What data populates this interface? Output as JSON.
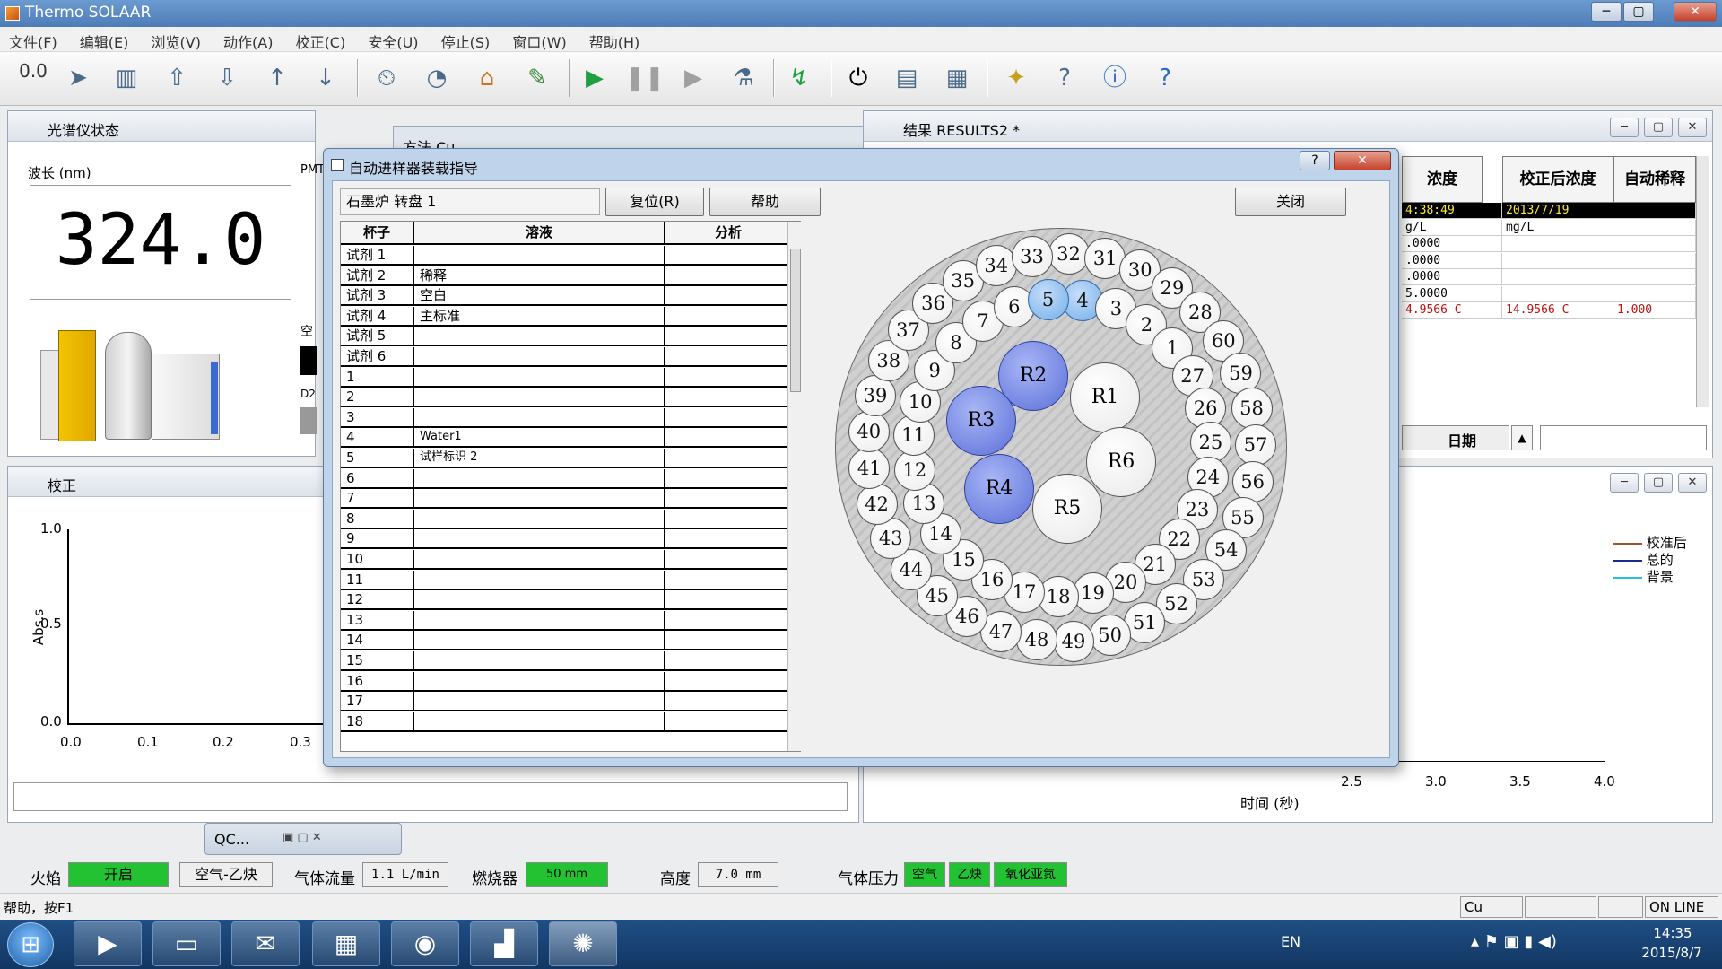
{
  "window": {
    "title": "Thermo SOLAAR",
    "min": "─",
    "max": "▢",
    "close": "✕"
  },
  "menu": [
    "文件(F)",
    "编辑(E)",
    "浏览(V)",
    "动作(A)",
    "校正(C)",
    "安全(U)",
    "停止(S)",
    "窗口(W)",
    "帮助(H)"
  ],
  "toolbar": {
    "icons": [
      "zero-icon",
      "autozero-icon",
      "lamp-icon",
      "sampler-up-icon",
      "sampler-down-icon",
      "arrow-up-icon",
      "arrow-down-icon",
      "timer-icon",
      "clock-icon",
      "clean-icon",
      "green-tool-icon",
      "play-icon",
      "pause-icon",
      "step-icon",
      "sample-icon",
      "sequence-icon",
      "power-icon",
      "instrument-icon",
      "report-icon",
      "wand-icon",
      "pointer-help-icon",
      "info-icon",
      "whats-this-icon"
    ],
    "zero_label": "0.0"
  },
  "spectro": {
    "title": "光谱仪状态",
    "wavelength_label": "波长 (nm)",
    "wavelength": "324.0",
    "pmt_label": "PMT",
    "air_label": "空",
    "d2_label": "D2"
  },
  "behind": {
    "method": "方法 Cu",
    "results": "结果 RESULTS2 *"
  },
  "results_table": {
    "headers": [
      "浓度",
      "校正后浓度",
      "自动稀释"
    ],
    "rows": [
      [
        "4:38:49",
        "2013/7/19",
        ""
      ],
      [
        "g/L",
        "mg/L",
        ""
      ],
      [
        ".0000",
        "",
        ""
      ],
      [
        ".0000",
        "",
        ""
      ],
      [
        ".0000",
        "",
        ""
      ],
      [
        "5.0000",
        "",
        ""
      ],
      [
        "4.9566 C",
        "14.9566 C",
        "1.000"
      ]
    ],
    "date_label": "日期"
  },
  "calib": {
    "title": "校正",
    "yaxis": "Abs.s",
    "yticks": [
      "1.0",
      "0.5",
      "0.0"
    ],
    "xticks": [
      "0.0",
      "0.1",
      "0.2",
      "0.3"
    ]
  },
  "right_plot": {
    "xticks": [
      "2.5",
      "3.0",
      "3.5",
      "4.0"
    ],
    "xlabel": "时间 (秒)",
    "legend": [
      "校准后",
      "总的",
      "背景"
    ],
    "legend_colors": [
      "#a0522d",
      "#1a2a8a",
      "#20c0e0"
    ]
  },
  "qc": {
    "title": "QC..."
  },
  "status": {
    "flame_label": "火焰",
    "flame_value": "开启",
    "gas_type": "空气-乙炔",
    "flow_label": "气体流量",
    "flow_value": "1.1 L/min",
    "burner_label": "燃烧器",
    "burner_value": "50 mm",
    "height_label": "高度",
    "height_value": "7.0 mm",
    "pressure_label": "气体压力",
    "pressure_items": [
      "空气",
      "乙炔",
      "氧化亚氮"
    ]
  },
  "statusline": {
    "help": "帮助，按F1",
    "element": "Cu",
    "online": "ON LINE"
  },
  "taskbar": {
    "lang": "EN",
    "time": "14:35",
    "date": "2015/8/7"
  },
  "dialog": {
    "title": "自动进样器装载指导",
    "furnace": "石墨炉  转盘 1",
    "reset": "复位(R)",
    "help": "帮助",
    "close": "关闭",
    "columns": [
      "杯子",
      "溶液",
      "分析"
    ],
    "rows": [
      [
        "试剂   1",
        "",
        ""
      ],
      [
        "试剂   2",
        "稀释",
        ""
      ],
      [
        "试剂   3",
        "空白",
        ""
      ],
      [
        "试剂   4",
        "主标准",
        ""
      ],
      [
        "试剂   5",
        "",
        ""
      ],
      [
        "试剂   6",
        "",
        ""
      ],
      [
        "1",
        "",
        ""
      ],
      [
        "2",
        "",
        ""
      ],
      [
        "3",
        "",
        ""
      ],
      [
        "4",
        "Water1",
        ""
      ],
      [
        "5",
        "试样标识 2",
        ""
      ],
      [
        "6",
        "",
        ""
      ],
      [
        "7",
        "",
        ""
      ],
      [
        "8",
        "",
        ""
      ],
      [
        "9",
        "",
        ""
      ],
      [
        "10",
        "",
        ""
      ],
      [
        "11",
        "",
        ""
      ],
      [
        "12",
        "",
        ""
      ],
      [
        "13",
        "",
        ""
      ],
      [
        "14",
        "",
        ""
      ],
      [
        "15",
        "",
        ""
      ],
      [
        "16",
        "",
        ""
      ],
      [
        "17",
        "",
        ""
      ],
      [
        "18",
        "",
        ""
      ]
    ],
    "tray": {
      "outer": [
        "32",
        "31",
        "30",
        "29",
        "28",
        "60",
        "59",
        "58",
        "57",
        "56",
        "55",
        "54",
        "53",
        "52",
        "51",
        "50",
        "49",
        "48",
        "47",
        "46",
        "45",
        "44",
        "43",
        "42",
        "41",
        "40",
        "39",
        "38",
        "37",
        "36",
        "35",
        "34",
        "33"
      ],
      "middle": [
        "4",
        "3",
        "2",
        "1",
        "27",
        "26",
        "25",
        "24",
        "23",
        "22",
        "21",
        "20",
        "19",
        "18",
        "17",
        "16",
        "15",
        "14",
        "13",
        "12",
        "11",
        "10",
        "9",
        "8",
        "7",
        "6",
        "5"
      ],
      "reagents": [
        "R1",
        "R2",
        "R3",
        "R4",
        "R5",
        "R6"
      ],
      "selected": [
        "4",
        "5"
      ],
      "selected_reagents": [
        "R2",
        "R3",
        "R4"
      ]
    }
  }
}
